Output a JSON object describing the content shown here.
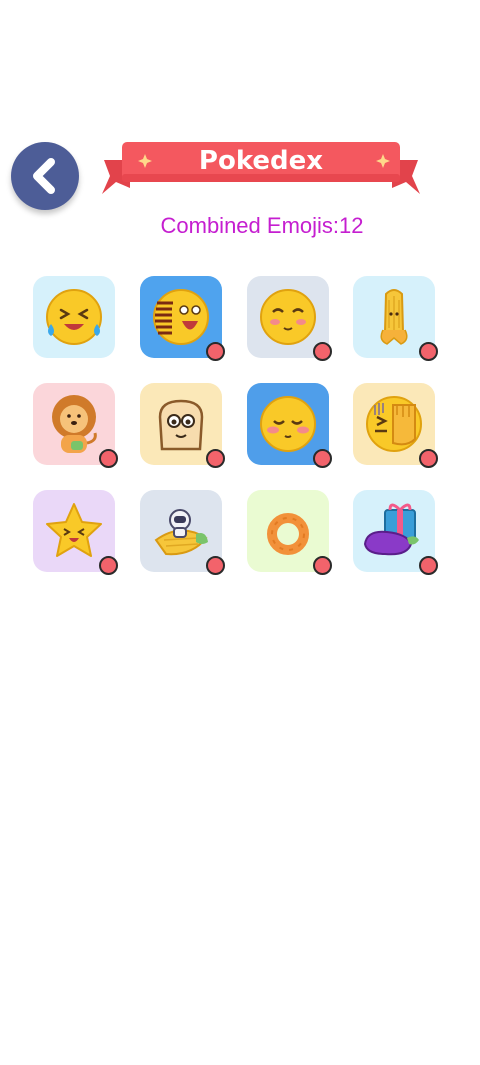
{
  "header": {
    "back_icon": "chevron-left-icon",
    "title": "Pokedex"
  },
  "stats": {
    "combined_label": "Combined Emojis:12"
  },
  "colors": {
    "back_button": "#4d5d97",
    "banner": "#f4585f",
    "count_text": "#c51ed0",
    "badge": "#f2636b"
  },
  "emojis": [
    {
      "icon": "laughing-tears-emoji",
      "bg": "#d6f1fb",
      "badge": false
    },
    {
      "icon": "shouting-face-emoji",
      "bg": "#4fa3ee",
      "badge": true
    },
    {
      "icon": "blushing-squint-emoji",
      "bg": "#dde4ee",
      "badge": true
    },
    {
      "icon": "corn-emoji",
      "bg": "#d6f1fb",
      "badge": true
    },
    {
      "icon": "lion-emoji",
      "bg": "#fbd6da",
      "badge": true
    },
    {
      "icon": "toast-bread-emoji",
      "bg": "#fbe8b8",
      "badge": true
    },
    {
      "icon": "smiling-blush-emoji",
      "bg": "#4f9eea",
      "badge": true
    },
    {
      "icon": "facepalm-emoji",
      "bg": "#fbe8b8",
      "badge": true
    },
    {
      "icon": "star-face-emoji",
      "bg": "#ead8f8",
      "badge": true
    },
    {
      "icon": "astronaut-corn-emoji",
      "bg": "#dde4ee",
      "badge": true
    },
    {
      "icon": "donut-ring-emoji",
      "bg": "#eafbd2",
      "badge": true
    },
    {
      "icon": "eggplant-gift-emoji",
      "bg": "#d6f1fb",
      "badge": true
    }
  ]
}
